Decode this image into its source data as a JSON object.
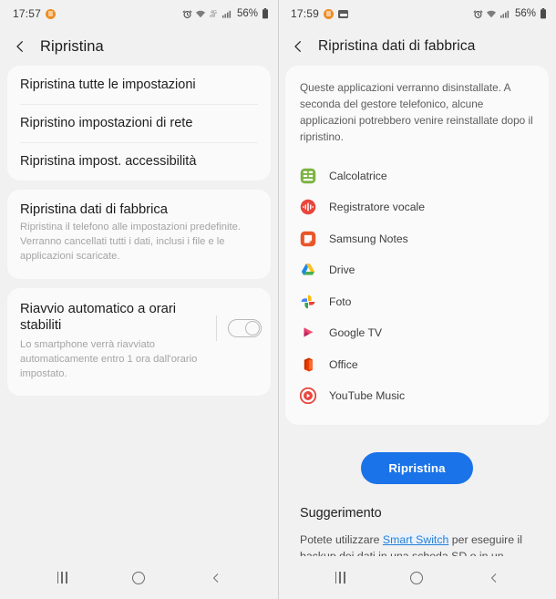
{
  "left": {
    "status": {
      "time": "17:57",
      "battery_percent": "56%",
      "icons": [
        "alarm-icon",
        "wifi-icon",
        "network-4g-icon",
        "signal-bars-icon",
        "battery-icon"
      ]
    },
    "title": "Ripristina",
    "settings_list": [
      {
        "label": "Ripristina tutte le impostazioni"
      },
      {
        "label": "Ripristino impostazioni di rete"
      },
      {
        "label": "Ripristina impost. accessibilità"
      }
    ],
    "factory_card": {
      "title": "Ripristina dati di fabbrica",
      "desc": "Ripristina il telefono alle impostazioni predefinite. Verranno cancellati tutti i dati, inclusi i file e le applicazioni scaricate."
    },
    "reboot_card": {
      "title": "Riavvio automatico a orari stabiliti",
      "desc": "Lo smartphone verrà riavviato automaticamente entro 1 ora dall'orario impostato.",
      "toggle_state": "off"
    }
  },
  "right": {
    "status": {
      "time": "17:59",
      "battery_percent": "56%",
      "icons": [
        "alarm-icon",
        "wifi-icon",
        "signal-bars-icon",
        "battery-icon",
        "screenshot-icon"
      ]
    },
    "title": "Ripristina dati di fabbrica",
    "info": "Queste applicazioni verranno disinstallate. A seconda del gestore telefonico, alcune applicazioni potrebbero venire reinstallate dopo il ripristino.",
    "apps": [
      {
        "name": "Calcolatrice",
        "icon": "calculator-icon"
      },
      {
        "name": "Registratore vocale",
        "icon": "voice-recorder-icon"
      },
      {
        "name": "Samsung Notes",
        "icon": "samsung-notes-icon"
      },
      {
        "name": "Drive",
        "icon": "google-drive-icon"
      },
      {
        "name": "Foto",
        "icon": "google-photos-icon"
      },
      {
        "name": "Google TV",
        "icon": "google-tv-icon"
      },
      {
        "name": "Office",
        "icon": "microsoft-office-icon"
      },
      {
        "name": "YouTube Music",
        "icon": "youtube-music-icon"
      }
    ],
    "primary_button": "Ripristina",
    "tip": {
      "title": "Suggerimento",
      "before_link": "Potete utilizzare ",
      "link": "Smart Switch",
      "after_link": " per eseguire il backup dei dati in una scheda SD o in un dispositivo di archiviazione USB prima di ripristinare lo smartphone."
    }
  },
  "navbar": {
    "recents_label": "recents-button",
    "home_label": "home-button",
    "back_label": "back-button"
  },
  "colors": {
    "accent": "#1a73e8",
    "link": "#2a7fd4",
    "page_bg": "#f1f1f1",
    "card_bg": "#fafafa"
  }
}
